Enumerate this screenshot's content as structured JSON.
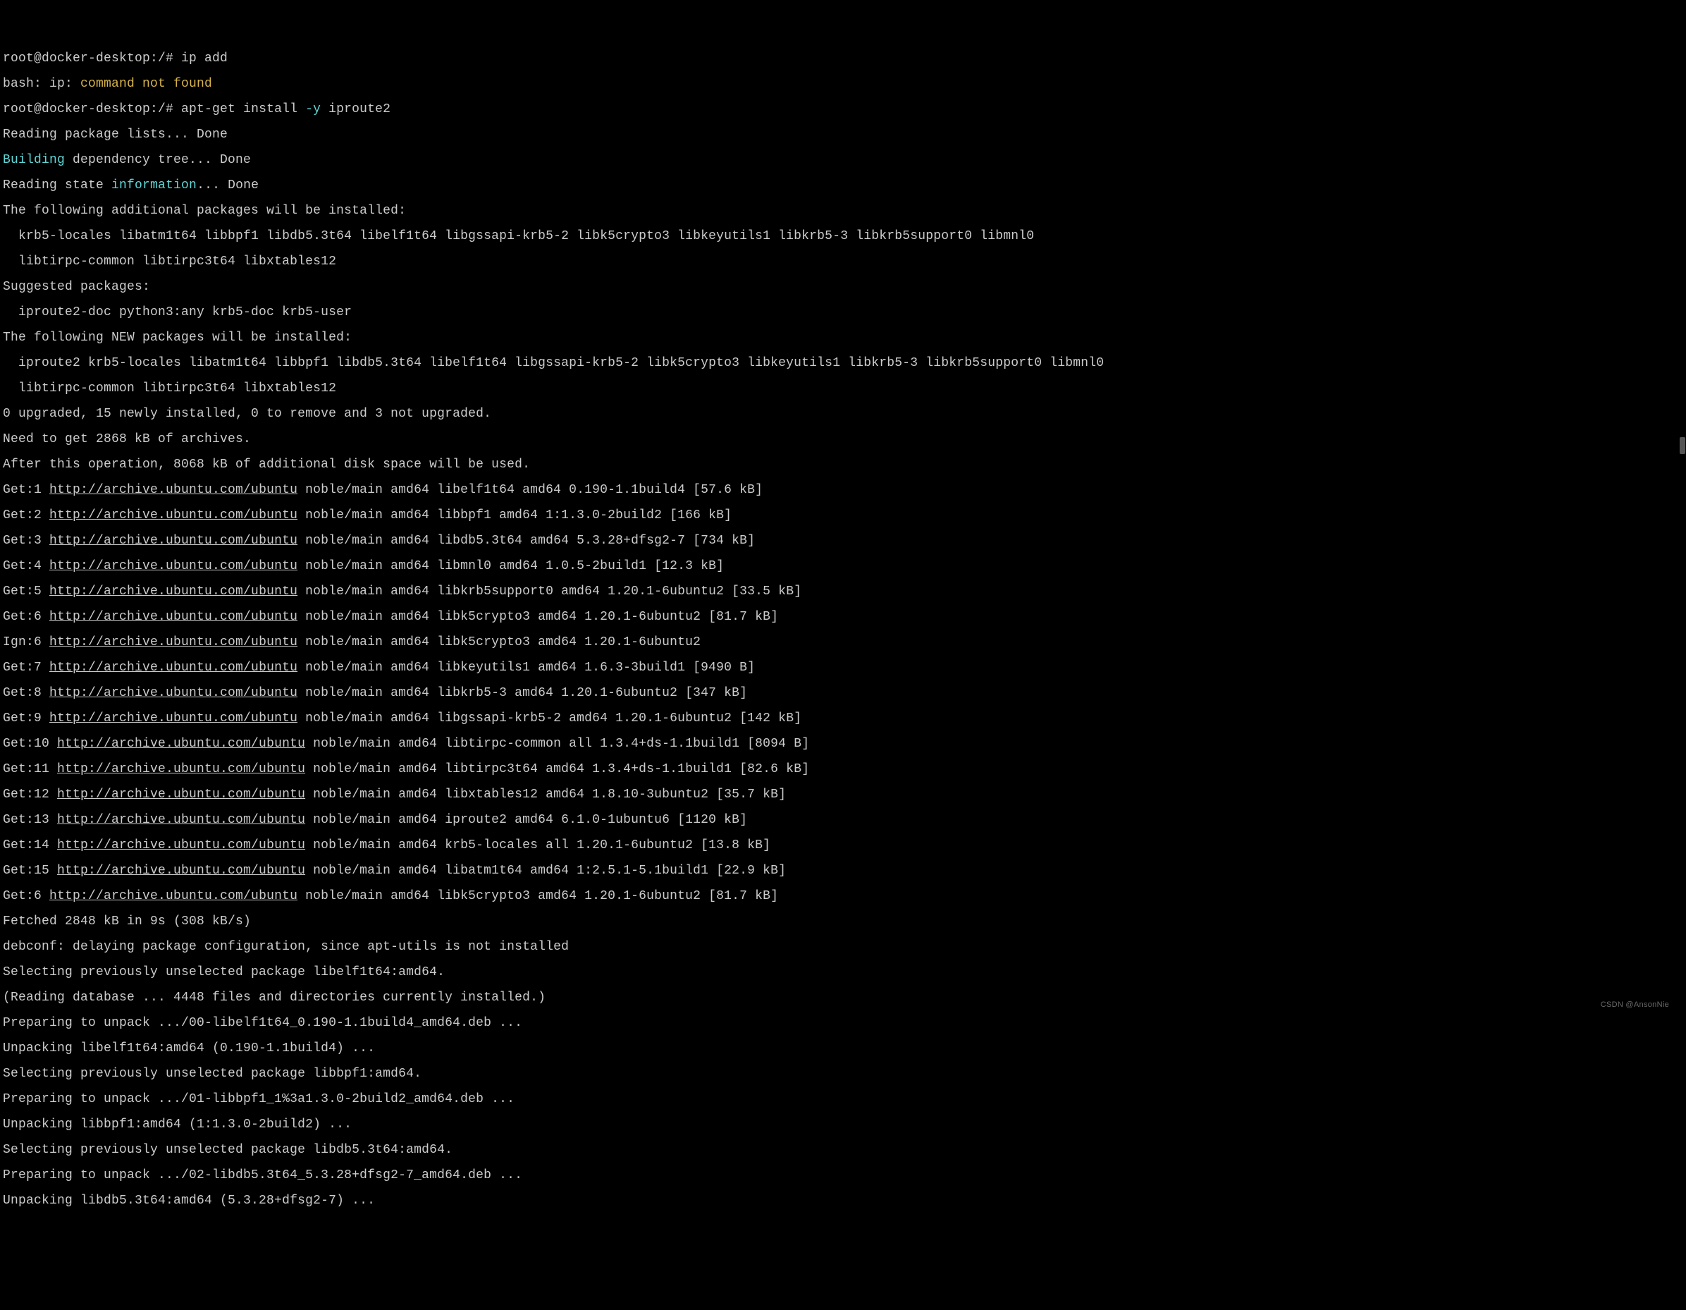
{
  "l1": {
    "prompt": "root@docker-desktop:/# ",
    "cmd": "ip add"
  },
  "l2a": "bash: ip: ",
  "l2b": "command not found",
  "l3": {
    "prompt": "root@docker-desktop:/# ",
    "cmd": "apt-get install ",
    "flag": "-y",
    "arg": " iproute2"
  },
  "l4": "Reading package lists... Done",
  "l5a": "Building",
  "l5b": " dependency tree... Done",
  "l6a": "Reading state ",
  "l6b": "information",
  "l6c": "... Done",
  "l7": "The following additional packages will be installed:",
  "l8": "  krb5-locales libatm1t64 libbpf1 libdb5.3t64 libelf1t64 libgssapi-krb5-2 libk5crypto3 libkeyutils1 libkrb5-3 libkrb5support0 libmnl0",
  "l9": "  libtirpc-common libtirpc3t64 libxtables12",
  "l10": "Suggested packages:",
  "l11": "  iproute2-doc python3:any krb5-doc krb5-user",
  "l12": "The following NEW packages will be installed:",
  "l13": "  iproute2 krb5-locales libatm1t64 libbpf1 libdb5.3t64 libelf1t64 libgssapi-krb5-2 libk5crypto3 libkeyutils1 libkrb5-3 libkrb5support0 libmnl0",
  "l14": "  libtirpc-common libtirpc3t64 libxtables12",
  "l15": "0 upgraded, 15 newly installed, 0 to remove and 3 not upgraded.",
  "l16": "Need to get 2868 kB of archives.",
  "l17": "After this operation, 8068 kB of additional disk space will be used.",
  "url": "http://archive.ubuntu.com/ubuntu",
  "g1a": "Get:1 ",
  "g1b": " noble/main amd64 libelf1t64 amd64 0.190-1.1build4 [57.6 kB]",
  "g2a": "Get:2 ",
  "g2b": " noble/main amd64 libbpf1 amd64 1:1.3.0-2build2 [166 kB]",
  "g3a": "Get:3 ",
  "g3b": " noble/main amd64 libdb5.3t64 amd64 5.3.28+dfsg2-7 [734 kB]",
  "g4a": "Get:4 ",
  "g4b": " noble/main amd64 libmnl0 amd64 1.0.5-2build1 [12.3 kB]",
  "g5a": "Get:5 ",
  "g5b": " noble/main amd64 libkrb5support0 amd64 1.20.1-6ubuntu2 [33.5 kB]",
  "g6a": "Get:6 ",
  "g6b": " noble/main amd64 libk5crypto3 amd64 1.20.1-6ubuntu2 [81.7 kB]",
  "i6a": "Ign:6 ",
  "i6b": " noble/main amd64 libk5crypto3 amd64 1.20.1-6ubuntu2",
  "g7a": "Get:7 ",
  "g7b": " noble/main amd64 libkeyutils1 amd64 1.6.3-3build1 [9490 B]",
  "g8a": "Get:8 ",
  "g8b": " noble/main amd64 libkrb5-3 amd64 1.20.1-6ubuntu2 [347 kB]",
  "g9a": "Get:9 ",
  "g9b": " noble/main amd64 libgssapi-krb5-2 amd64 1.20.1-6ubuntu2 [142 kB]",
  "g10a": "Get:10 ",
  "g10b": " noble/main amd64 libtirpc-common all 1.3.4+ds-1.1build1 [8094 B]",
  "g11a": "Get:11 ",
  "g11b": " noble/main amd64 libtirpc3t64 amd64 1.3.4+ds-1.1build1 [82.6 kB]",
  "g12a": "Get:12 ",
  "g12b": " noble/main amd64 libxtables12 amd64 1.8.10-3ubuntu2 [35.7 kB]",
  "g13a": "Get:13 ",
  "g13b": " noble/main amd64 iproute2 amd64 6.1.0-1ubuntu6 [1120 kB]",
  "g14a": "Get:14 ",
  "g14b": " noble/main amd64 krb5-locales all 1.20.1-6ubuntu2 [13.8 kB]",
  "g15a": "Get:15 ",
  "g15b": " noble/main amd64 libatm1t64 amd64 1:2.5.1-5.1build1 [22.9 kB]",
  "g16a": "Get:6 ",
  "g16b": " noble/main amd64 libk5crypto3 amd64 1.20.1-6ubuntu2 [81.7 kB]",
  "l35": "Fetched 2848 kB in 9s (308 kB/s)",
  "l36": "debconf: delaying package configuration, since apt-utils is not installed",
  "l37": "Selecting previously unselected package libelf1t64:amd64.",
  "l38": "(Reading database ... 4448 files and directories currently installed.)",
  "l39": "Preparing to unpack .../00-libelf1t64_0.190-1.1build4_amd64.deb ...",
  "l40": "Unpacking libelf1t64:amd64 (0.190-1.1build4) ...",
  "l41": "Selecting previously unselected package libbpf1:amd64.",
  "l42": "Preparing to unpack .../01-libbpf1_1%3a1.3.0-2build2_amd64.deb ...",
  "l43": "Unpacking libbpf1:amd64 (1:1.3.0-2build2) ...",
  "l44": "Selecting previously unselected package libdb5.3t64:amd64.",
  "l45": "Preparing to unpack .../02-libdb5.3t64_5.3.28+dfsg2-7_amd64.deb ...",
  "l46": "Unpacking libdb5.3t64:amd64 (5.3.28+dfsg2-7) ...",
  "watermark": "CSDN @AnsonNie"
}
